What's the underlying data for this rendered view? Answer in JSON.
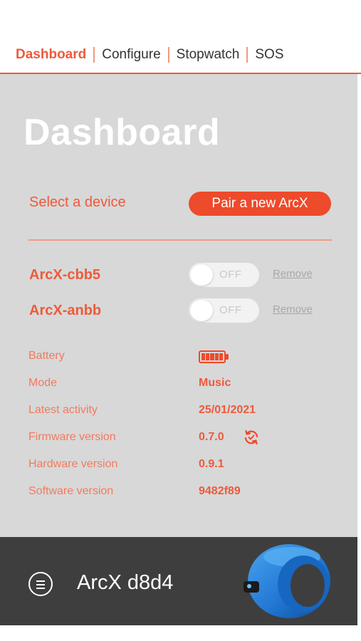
{
  "nav": {
    "tabs": [
      {
        "label": "Dashboard",
        "active": true
      },
      {
        "label": "Configure",
        "active": false
      },
      {
        "label": "Stopwatch",
        "active": false
      },
      {
        "label": "SOS",
        "active": false
      }
    ]
  },
  "dashboard": {
    "title": "Dashboard",
    "select_label": "Select a device",
    "pair_button": "Pair a new ArcX"
  },
  "devices": [
    {
      "name": "ArcX-cbb5",
      "toggle_label": "OFF",
      "toggle_on": false,
      "remove_label": "Remove"
    },
    {
      "name": "ArcX-anbb",
      "toggle_label": "OFF",
      "toggle_on": false,
      "remove_label": "Remove"
    }
  ],
  "info": {
    "battery": {
      "label": "Battery",
      "level_fraction": 1.0,
      "icon": "battery-full-icon"
    },
    "mode": {
      "label": "Mode",
      "value": "Music"
    },
    "latest_activity": {
      "label": "Latest activity",
      "value": "25/01/2021"
    },
    "firmware": {
      "label": "Firmware version",
      "value": "0.7.0",
      "icon": "firmware-update-icon"
    },
    "hardware": {
      "label": "Hardware version",
      "value": "0.9.1"
    },
    "software": {
      "label": "Software version",
      "value": "9482f89"
    }
  },
  "footer": {
    "menu_icon": "menu-icon",
    "device_name": "ArcX d8d4",
    "device_image": "arcx-ring-image"
  },
  "colors": {
    "accent": "#ee5a3a",
    "button": "#ee4a2c",
    "panel_bg": "#d8d8d8",
    "footer_bg": "#3e3e3e"
  }
}
